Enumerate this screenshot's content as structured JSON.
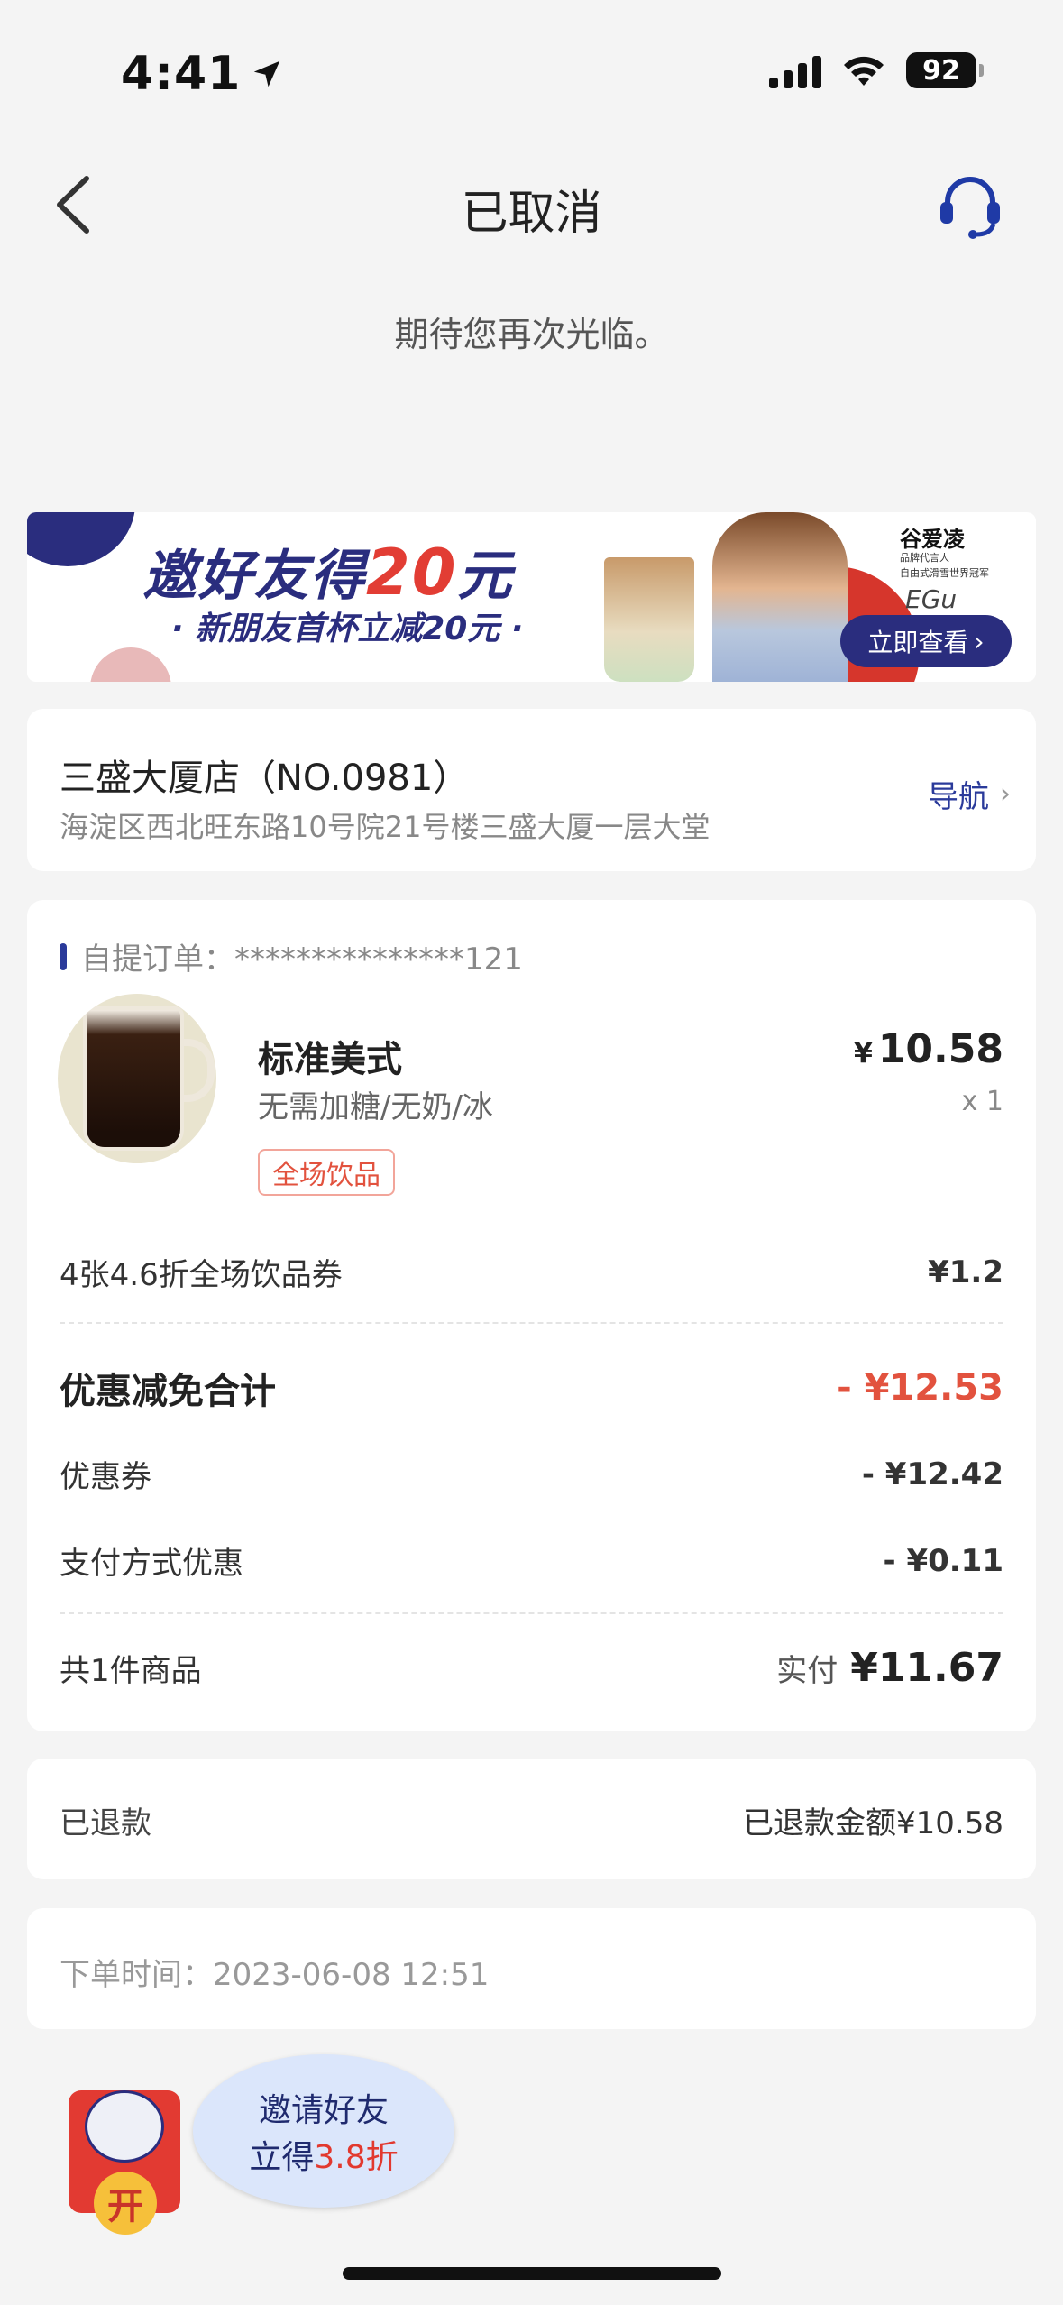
{
  "status_bar": {
    "time": "4:41",
    "battery": "92"
  },
  "nav": {
    "title": "已取消"
  },
  "subtitle": "期待您再次光临。",
  "banner": {
    "title_prefix": "邀好友得",
    "title_amount": "20",
    "title_suffix": "元",
    "subtitle": "· 新朋友首杯立减20元 ·",
    "celebrity_name": "谷爱凌",
    "celebrity_line1": "品牌代言人",
    "celebrity_line2": "自由式滑雪世界冠军",
    "signature": "EGu",
    "button_label": "立即查看"
  },
  "store": {
    "name": "三盛大厦店（NO.0981）",
    "address": "海淀区西北旺东路10号院21号楼三盛大厦一层大堂",
    "nav_label": "导航"
  },
  "order": {
    "id_label": "自提订单：",
    "id_value": "***************121",
    "product": {
      "name": "标准美式",
      "spec": "无需加糖/无奶/冰",
      "tag": "全场饮品",
      "price": "10.58",
      "currency": "¥",
      "qty": "x 1"
    },
    "coupon_line": {
      "label": "4张4.6折全场饮品券",
      "value": "¥1.2"
    },
    "discount_total": {
      "label": "优惠减免合计",
      "value": "- ¥12.53"
    },
    "coupon": {
      "label": "优惠券",
      "value": "- ¥12.42"
    },
    "pay_discount": {
      "label": "支付方式优惠",
      "value": "- ¥0.11"
    },
    "item_count": {
      "label": "共1件商品",
      "paid_label": "实付",
      "paid_value": "¥11.67"
    }
  },
  "refund": {
    "label": "已退款",
    "value": "已退款金额¥10.58"
  },
  "order_time": {
    "label": "下单时间：2023-06-08 12:51"
  },
  "invite": {
    "hongbao_char": "开",
    "line1": "邀请好友",
    "line2_prefix": "立得",
    "line2_highlight": "3.8折"
  },
  "colors": {
    "accent": "#2a3a9a",
    "brand_dark": "#2a2d7e",
    "discount_red": "#e2523e",
    "background": "#f4f4f4"
  }
}
